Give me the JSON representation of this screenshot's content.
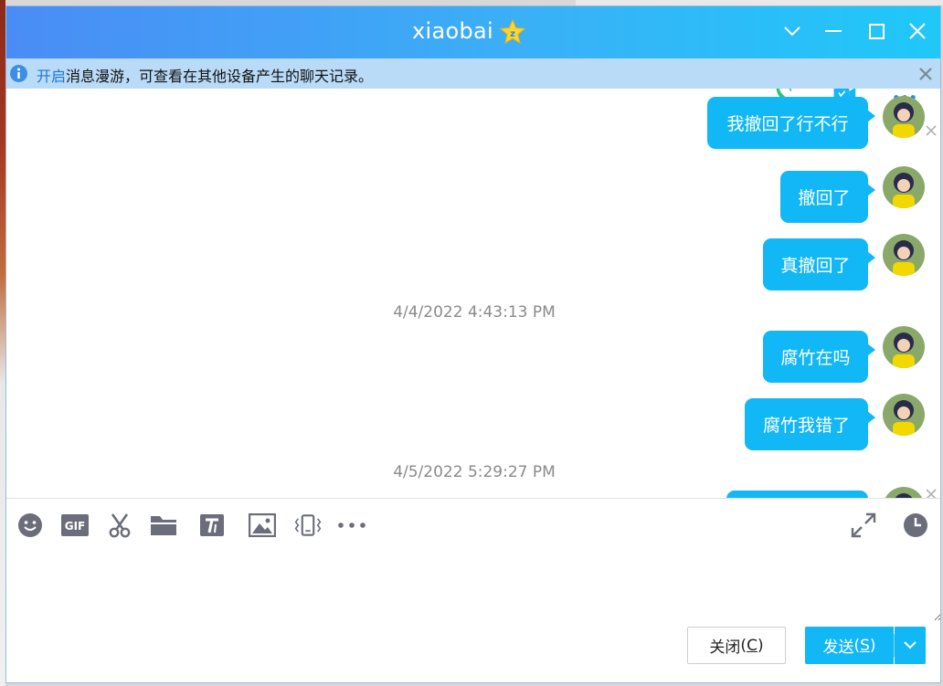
{
  "window": {
    "title": "xiaobai",
    "title_badge_icon": "vip-star-icon",
    "controls": [
      "chevron-down-icon",
      "minimize-icon",
      "maximize-icon",
      "close-icon"
    ]
  },
  "notice": {
    "link_text": "开启",
    "text": "消息漫游，可查看在其他设备产生的聊天记录。",
    "icon": "info-icon"
  },
  "chat_header_icons": [
    "voice-call-icon",
    "video-call-icon",
    "more-icon"
  ],
  "messages": [
    {
      "text": "我撤回了行不行",
      "sender": "self"
    },
    {
      "text": "撤回了",
      "sender": "self"
    },
    {
      "text": "真撤回了",
      "sender": "self"
    },
    {
      "text": "腐竹在吗",
      "sender": "self"
    },
    {
      "text": "腐竹我错了",
      "sender": "self"
    },
    {
      "text": "",
      "sender": "self"
    }
  ],
  "timestamps": [
    "4/4/2022 4:43:13 PM",
    "4/5/2022 5:29:27 PM"
  ],
  "toolbar": {
    "left_tools": [
      "emoji-icon",
      "gif-icon",
      "screenshot-scissors-icon",
      "file-folder-icon",
      "font-style-icon",
      "image-icon",
      "shake-window-icon",
      "more-tools-icon"
    ],
    "right_tools": [
      "expand-icon",
      "history-clock-icon"
    ]
  },
  "input": {
    "value": "",
    "placeholder": ""
  },
  "buttons": {
    "close_label": "关闭",
    "close_key": "C",
    "send_label": "发送",
    "send_key": "S"
  },
  "colors": {
    "title_gradient_start": "#4a8cf5",
    "title_gradient_end": "#1fc8f8",
    "notice_bg": "#b9dbf7",
    "bubble": "#12b7f5",
    "icon_gray": "#6b6e7a"
  }
}
